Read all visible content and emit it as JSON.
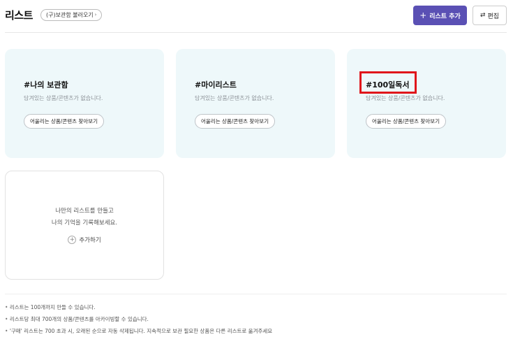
{
  "header": {
    "title": "리스트",
    "legacy_button": "(구)보관함 불러오기",
    "add_list_button": "리스트 추가",
    "edit_button": "편집"
  },
  "lists": [
    {
      "title": "#나의 보관함",
      "description": "담겨있는 상품/콘텐츠가 없습니다.",
      "action": "어울리는 상품/콘텐츠 찾아보기"
    },
    {
      "title": "#마이리스트",
      "description": "담겨있는 상품/콘텐츠가 없습니다.",
      "action": "어울리는 상품/콘텐츠 찾아보기"
    },
    {
      "title": "#100일독서",
      "description": "담겨있는 상품/콘텐츠가 없습니다.",
      "action": "어울리는 상품/콘텐츠 찾아보기"
    }
  ],
  "new_list": {
    "line1": "나만의 리스트를 만들고",
    "line2": "나의 기억을 기록해보세요.",
    "add_label": "추가하기"
  },
  "notes": [
    "리스트는 100개까지 만들 수 있습니다.",
    "리스트당 최대 700개의 상품/콘텐츠를 아카이빙할 수 있습니다.",
    "'구매' 리스트는 700 초과 시, 오래된 순으로 자동 삭제됩니다. 지속적으로 보관 필요한 상품은 다른 리스트로 옮겨주세요"
  ],
  "colors": {
    "accent": "#5a50b4",
    "card_bg": "#eef8fa",
    "highlight": "#e0161b"
  }
}
